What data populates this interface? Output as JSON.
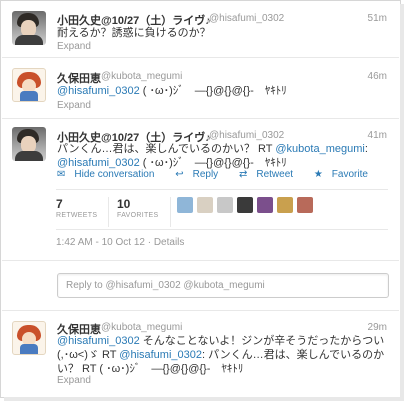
{
  "tweets": [
    {
      "name": "小田久史@10/27（土）ライヴ♪",
      "handle": "@hisafumi_0302",
      "time": "51m",
      "text": "耐えるか？誘惑に負けるのか？",
      "expand": "Expand"
    },
    {
      "name": "久保田恵",
      "handle": "@kubota_megumi",
      "time": "46m",
      "mention": "@hisafumi_0302",
      "text": " ( ･ω･)ｼﾞ　―{}@{}@{}-　ﾔｷﾄﾘ",
      "expand": "Expand"
    },
    {
      "name": "小田久史@10/27（土）ライヴ♪",
      "handle": "@hisafumi_0302",
      "time": "41m",
      "text_part1": "パンくん…君は、楽しんでいるのかい？ RT ",
      "mention1": "@kubota_megumi",
      "text_part2": ":",
      "mention2": "@hisafumi_0302",
      "text_part3": " ( ･ω･)ｼﾞ　―{}@{}@{}-　ﾔｷﾄﾘ",
      "actions": {
        "hide": "Hide conversation",
        "reply": "Reply",
        "retweet": "Retweet",
        "favorite": "Favorite"
      },
      "stats": {
        "retweets_count": "7",
        "retweets_label": "RETWEETS",
        "favorites_count": "10",
        "favorites_label": "FAVORITES"
      },
      "meta": "1:42 AM - 10 Oct 12 · Details"
    },
    {
      "name": "久保田恵",
      "handle": "@kubota_megumi",
      "time": "29m",
      "mention1": "@hisafumi_0302",
      "text_part1": " そんなことないよ！ジンが辛そうだったからつい(,･ω<)ゞ RT ",
      "mention2": "@hisafumi_0302",
      "text_part2": ": パンくん…君は、楽しんでいるのかい？ RT ( ･ω･)ｼﾞ　―{}@{}@{}-　ﾔｷﾄﾘ",
      "expand": "Expand"
    }
  ],
  "reply_placeholder": "Reply to @hisafumi_0302 @kubota_megumi",
  "icons": {
    "hide": "chat-bubble-icon",
    "reply": "reply-arrow-icon",
    "retweet": "retweet-icon",
    "favorite": "star-icon"
  },
  "colors": {
    "link": "#2a7ab5",
    "text": "#333333",
    "muted": "#999999",
    "border": "#e8e8e8"
  }
}
